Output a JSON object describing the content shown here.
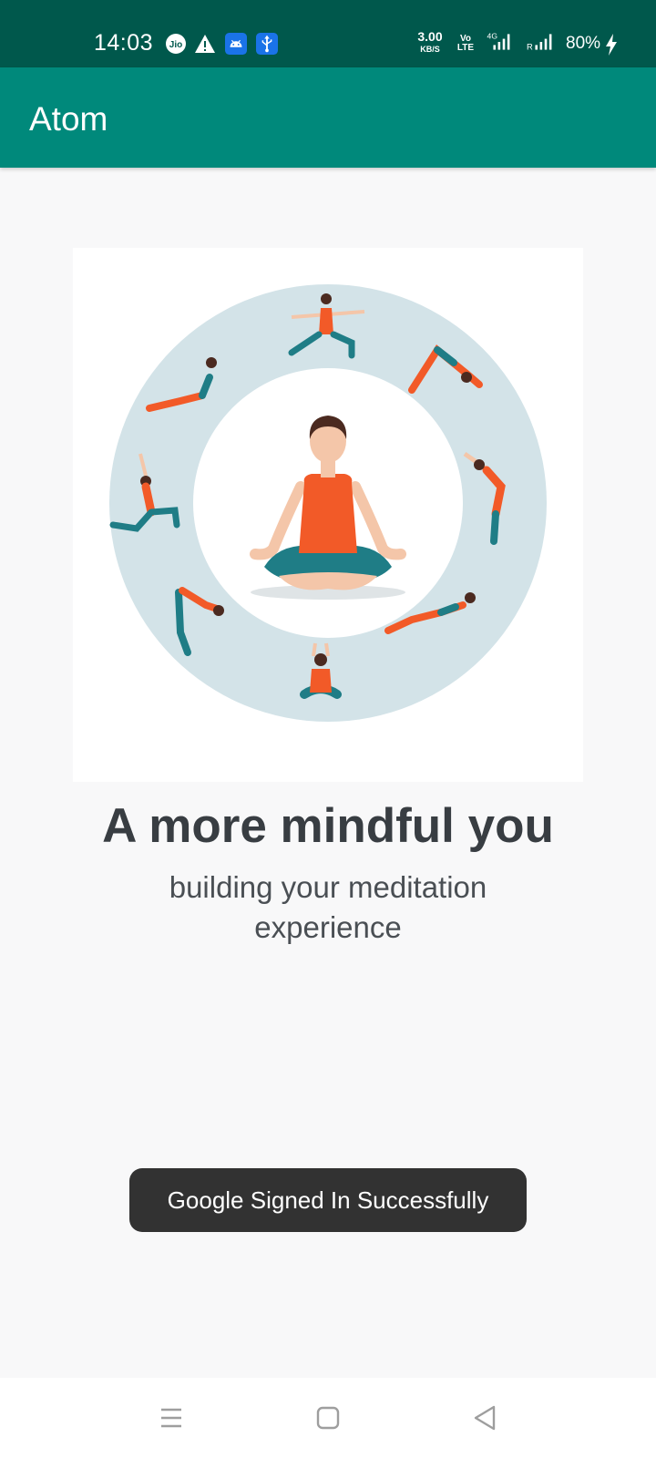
{
  "status_bar": {
    "time": "14:03",
    "carrier_icon": "jio-icon",
    "icons": [
      "warning-icon",
      "android-icon",
      "usb-icon"
    ],
    "net_speed": "3.00",
    "net_speed_unit": "KB/S",
    "volte_top": "Vo",
    "volte_bottom": "LTE",
    "network": "4G",
    "roaming": "R",
    "battery": "80%",
    "charging_icon": "bolt-icon"
  },
  "app_bar": {
    "title": "Atom"
  },
  "hero": {
    "illustration": "yoga-poses-meditation-illustration"
  },
  "headline": "A more mindful you",
  "subline": "building your meditation experience",
  "toast": {
    "message": "Google Signed In Successfully"
  },
  "nav_bar": {
    "buttons": [
      "recents-icon",
      "home-icon",
      "back-icon"
    ]
  },
  "colors": {
    "status_bar": "#00584c",
    "app_bar": "#00897b",
    "background": "#f8f8f9",
    "ring": "#d3e3e8",
    "orange": "#f25a28",
    "teal": "#1f7d86",
    "skin": "#f4c6a9",
    "hair": "#4b2a20",
    "headline": "#383d42",
    "toast": "#323232"
  }
}
